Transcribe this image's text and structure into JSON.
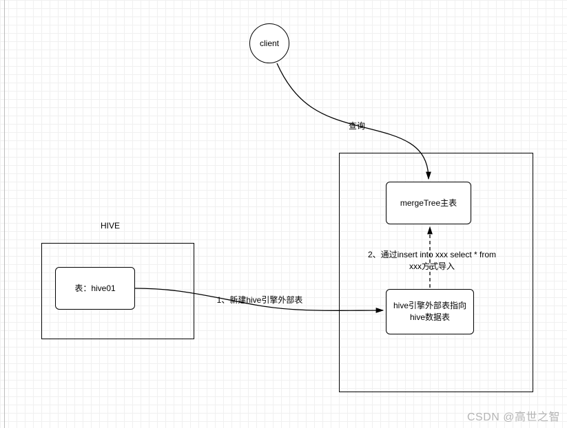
{
  "nodes": {
    "client": {
      "label": "client"
    },
    "hive_title": {
      "label": "HIVE"
    },
    "hive_table": {
      "label": "表：hive01"
    },
    "mergetree": {
      "label": "mergeTree主表"
    },
    "hive_engine": {
      "label": "hive引擎外部表指向hive数据表"
    }
  },
  "edges": {
    "query": {
      "label": "查询"
    },
    "step1": {
      "label": "1、新建hive引擎外部表"
    },
    "step2": {
      "label": "2、通过insert into xxx select * from xxx方式导入"
    }
  },
  "watermark": "CSDN @高世之智"
}
